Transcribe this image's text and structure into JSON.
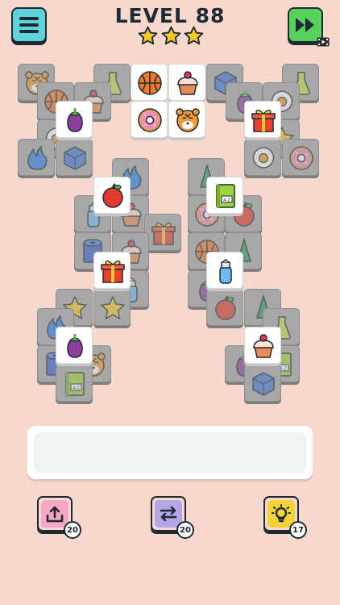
{
  "header": {
    "level_label": "LEVEL 88",
    "stars_earned": 3,
    "stars_total": 3
  },
  "icons": {
    "menu": "hamburger-menu-icon",
    "skip": "fast-forward-icon",
    "video_ad": "video-ad-icon"
  },
  "tray": {
    "slots_filled": 0
  },
  "tools": [
    {
      "name": "undo",
      "icon": "undo-arrow-icon",
      "count": "20",
      "color": "#f7a7c5"
    },
    {
      "name": "shuffle",
      "icon": "shuffle-arrows-icon",
      "count": "20",
      "color": "#b6a6e6"
    },
    {
      "name": "hint",
      "icon": "lightbulb-icon",
      "count": "17",
      "color": "#f4d338"
    }
  ],
  "colors": {
    "background": "#f6d8cf",
    "menu_button": "#5fd3db",
    "skip_button": "#56d15c",
    "star": "#f5c928",
    "outline": "#1d2a33"
  },
  "tiles": [
    {
      "item": "tiger",
      "state": "covered"
    },
    {
      "item": "potion",
      "state": "covered"
    },
    {
      "item": "basketball",
      "state": "open"
    },
    {
      "item": "cupcake",
      "state": "open"
    },
    {
      "item": "cube",
      "state": "covered"
    },
    {
      "item": "potion",
      "state": "covered"
    },
    {
      "item": "basketball",
      "state": "covered"
    },
    {
      "item": "cupcake",
      "state": "covered"
    },
    {
      "item": "donut",
      "state": "open"
    },
    {
      "item": "tiger",
      "state": "open"
    },
    {
      "item": "eggplant",
      "state": "covered"
    },
    {
      "item": "fried-egg",
      "state": "covered"
    },
    {
      "item": "eggplant",
      "state": "open"
    },
    {
      "item": "gift",
      "state": "open"
    },
    {
      "item": "fried-egg",
      "state": "covered"
    },
    {
      "item": "star",
      "state": "covered"
    },
    {
      "item": "fire",
      "state": "covered"
    },
    {
      "item": "cube",
      "state": "covered"
    },
    {
      "item": "fried-egg",
      "state": "covered"
    },
    {
      "item": "donut",
      "state": "covered"
    },
    {
      "item": "fire",
      "state": "covered"
    },
    {
      "item": "tree",
      "state": "covered"
    },
    {
      "item": "apple",
      "state": "open"
    },
    {
      "item": "book",
      "state": "open"
    },
    {
      "item": "bottle",
      "state": "covered"
    },
    {
      "item": "cupcake",
      "state": "covered"
    },
    {
      "item": "gift",
      "state": "covered"
    },
    {
      "item": "potion",
      "state": "covered"
    },
    {
      "item": "donut",
      "state": "covered"
    },
    {
      "item": "apple",
      "state": "covered"
    },
    {
      "item": "toilet-roll",
      "state": "covered"
    },
    {
      "item": "cupcake",
      "state": "covered"
    },
    {
      "item": "basketball",
      "state": "covered"
    },
    {
      "item": "tree",
      "state": "covered"
    },
    {
      "item": "gift",
      "state": "open"
    },
    {
      "item": "bottle",
      "state": "open"
    },
    {
      "item": "bottle",
      "state": "covered"
    },
    {
      "item": "eggplant",
      "state": "covered"
    },
    {
      "item": "star",
      "state": "covered"
    },
    {
      "item": "star",
      "state": "covered"
    },
    {
      "item": "apple",
      "state": "covered"
    },
    {
      "item": "tree",
      "state": "covered"
    },
    {
      "item": "fire",
      "state": "covered"
    },
    {
      "item": "potion",
      "state": "covered"
    },
    {
      "item": "eggplant",
      "state": "open"
    },
    {
      "item": "cupcake",
      "state": "open"
    },
    {
      "item": "toilet-roll",
      "state": "covered"
    },
    {
      "item": "tiger",
      "state": "covered"
    },
    {
      "item": "eggplant",
      "state": "covered"
    },
    {
      "item": "book",
      "state": "covered"
    },
    {
      "item": "book",
      "state": "covered"
    },
    {
      "item": "cube",
      "state": "covered"
    }
  ]
}
